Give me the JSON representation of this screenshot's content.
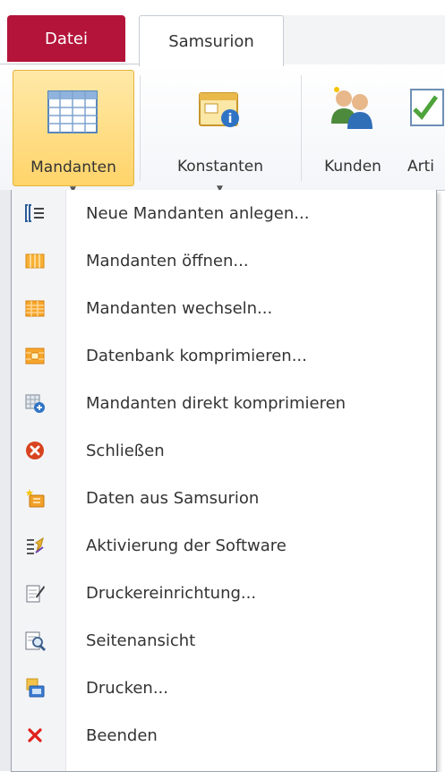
{
  "tabs": {
    "file": "Datei",
    "active": "Samsurion"
  },
  "ribbon": {
    "mandanten": "Mandanten",
    "konstanten": "Konstanten",
    "kunden": "Kunden",
    "artikel": "Arti"
  },
  "menu": {
    "items": [
      {
        "label": "Neue Mandanten anlegen...",
        "icon": "new-list-icon"
      },
      {
        "label": "Mandanten öffnen...",
        "icon": "open-table-icon"
      },
      {
        "label": "Mandanten wechseln...",
        "icon": "switch-table-icon"
      },
      {
        "label": "Datenbank komprimieren...",
        "icon": "compress-table-icon"
      },
      {
        "label": "Mandanten direkt komprimieren",
        "icon": "compress-direct-icon"
      },
      {
        "label": "Schließen",
        "icon": "close-circle-icon"
      },
      {
        "label": "Daten aus Samsurion",
        "icon": "import-data-icon"
      },
      {
        "label": "Aktivierung der Software",
        "icon": "activation-icon"
      },
      {
        "label": "Druckereinrichtung...",
        "icon": "printer-setup-icon"
      },
      {
        "label": "Seitenansicht",
        "icon": "page-preview-icon"
      },
      {
        "label": "Drucken...",
        "icon": "print-icon"
      },
      {
        "label": "Beenden",
        "icon": "exit-x-icon"
      }
    ]
  },
  "colors": {
    "file_tab": "#b4143a",
    "selected_button": "#ffd46a",
    "close_red": "#d8431f",
    "exit_red": "#e0201b"
  }
}
